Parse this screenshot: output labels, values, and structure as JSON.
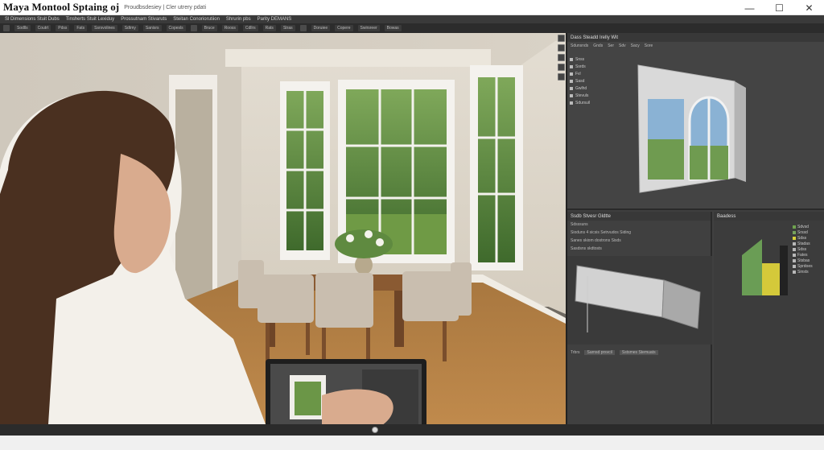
{
  "window": {
    "title": "Maya Montool Sptaing oj",
    "subtitle": "Proudbsdesiey | Cler utrery pdati",
    "controls": {
      "minimize": "—",
      "maximize": "☐",
      "close": "✕"
    }
  },
  "menu": {
    "items": [
      "Sl Dimensions Stuit Dubs",
      "Tinsherts Stuit Lexiduy",
      "Prossutnam Stivaruts",
      "Steitan Conoriorutiion",
      "Shrurin pbs",
      "Parity DEMANS"
    ]
  },
  "toolbar": {
    "items": [
      "Sodlls",
      "Coutrt",
      "Pdss",
      "Fats",
      "Ssrsvolines",
      "Sdtmy",
      "Sanisrs",
      "Copesls",
      "Bruce",
      "Rooss",
      "Cdllrs",
      "Rats",
      "Stras",
      "Doruiee",
      "Copere",
      "Swirsreer",
      "Bowas"
    ]
  },
  "top_panel": {
    "title": "Dass Steadd Irelly Wit",
    "tabs": [
      "Sdunsnds",
      "Gnds",
      "Ser",
      "Sdv",
      "Sacy",
      "Sore"
    ],
    "attributes": [
      "Snss",
      "Ssrds",
      "Fvl",
      "Sasd",
      "Gwlhd",
      "Stevuls",
      "Sdursuil"
    ]
  },
  "outliner": {
    "title": "Ssdb Stvesr Gldtte",
    "tab": "Sdsssuns",
    "rows": [
      "Sioduns 4 sicsis Setrvudos Siding",
      "Sanes skiom dostrons Sisds",
      "Sasdsns skdtosts"
    ],
    "footer_left": "Trbrs",
    "footer_buttons": [
      "Sarnsd prsvcil",
      "Sstsmes Stemuats"
    ]
  },
  "graph": {
    "header": "Baadess",
    "legend": [
      {
        "label": "Sdvsd",
        "color": "#6fa34f"
      },
      {
        "label": "Srssd",
        "color": "#77a25d"
      },
      {
        "label": "Sdss",
        "color": "#d8cf39"
      },
      {
        "label": "Stadas",
        "color": "#b8b8b8"
      },
      {
        "label": "Sdss",
        "color": "#b8b8b8"
      },
      {
        "label": "Fates",
        "color": "#b8b8b8"
      },
      {
        "label": "Stsbas",
        "color": "#b8b8b8"
      },
      {
        "label": "Sprdoes",
        "color": "#b8b8b8"
      },
      {
        "label": "Sinsts",
        "color": "#b8b8b8"
      }
    ]
  },
  "colors": {
    "accent_green": "#6a9d55",
    "accent_yellow": "#d4c93a",
    "panel_dark": "#3f3f3f"
  }
}
